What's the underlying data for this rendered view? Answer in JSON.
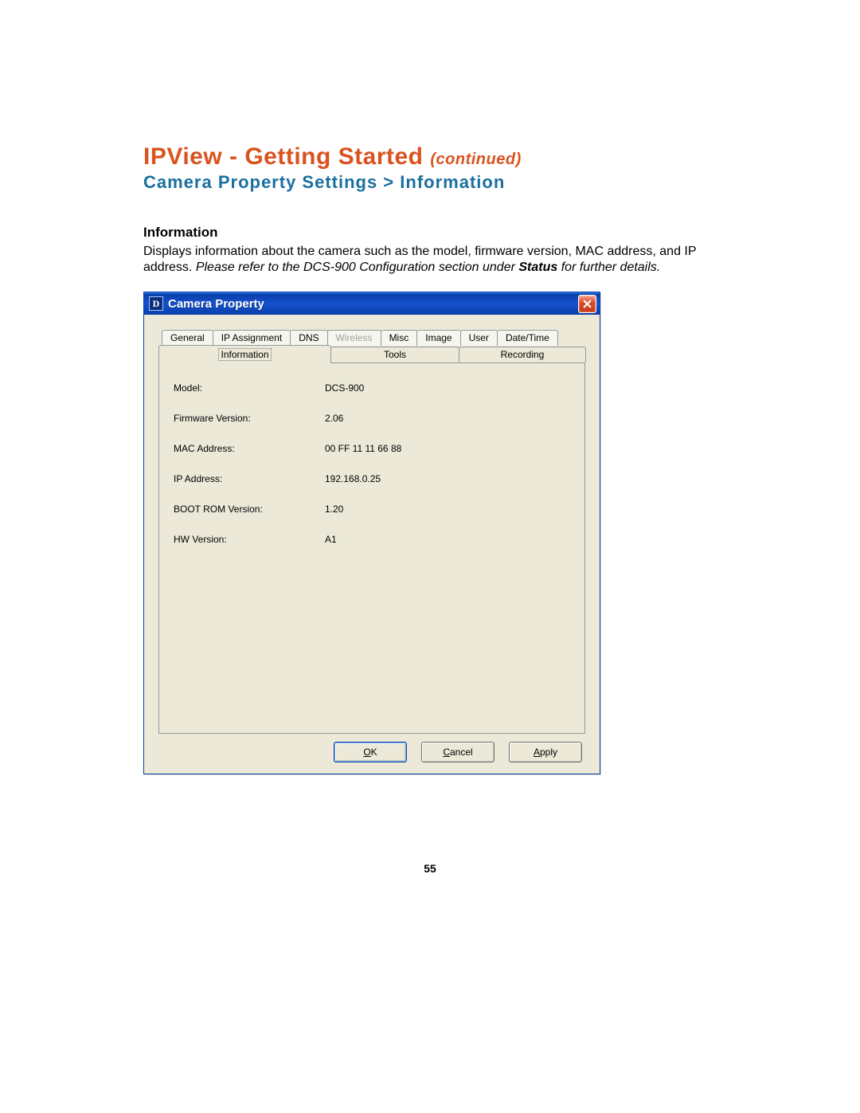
{
  "heading": {
    "main_prefix": "IPView - Getting Started",
    "main_suffix": "(continued)",
    "sub": "Camera Property Settings > Information"
  },
  "section": {
    "label": "Information",
    "para_plain1": "Displays information about the camera such as the model, firmware version, MAC address, and IP address. ",
    "para_ital1": "Please refer to the DCS-900 Configuration section under ",
    "para_boldital": "Status",
    "para_ital2": "  for further details."
  },
  "window": {
    "title": "Camera Property",
    "logo_letter": "D",
    "tabs_back": [
      {
        "label": "General",
        "disabled": false
      },
      {
        "label": "IP Assignment",
        "disabled": false
      },
      {
        "label": "DNS",
        "disabled": false
      },
      {
        "label": "Wireless",
        "disabled": true
      },
      {
        "label": "Misc",
        "disabled": false
      },
      {
        "label": "Image",
        "disabled": false
      },
      {
        "label": "User",
        "disabled": false
      },
      {
        "label": "Date/Time",
        "disabled": false
      }
    ],
    "tabs_front": [
      {
        "label": "Information",
        "active": true
      },
      {
        "label": "Tools",
        "active": false
      },
      {
        "label": "Recording",
        "active": false
      }
    ],
    "info": [
      {
        "k": "Model:",
        "v": "DCS-900"
      },
      {
        "k": "Firmware Version:",
        "v": "2.06"
      },
      {
        "k": "MAC Address:",
        "v": "00 FF 11 11 66 88"
      },
      {
        "k": "IP Address:",
        "v": "192.168.0.25"
      },
      {
        "k": "BOOT ROM Version:",
        "v": "1.20"
      },
      {
        "k": "HW Version:",
        "v": "A1"
      }
    ],
    "buttons": {
      "ok_u": "O",
      "ok_rest": "K",
      "cancel_u": "C",
      "cancel_rest": "ancel",
      "apply_u": "A",
      "apply_rest": "pply"
    }
  },
  "page_number": "55"
}
